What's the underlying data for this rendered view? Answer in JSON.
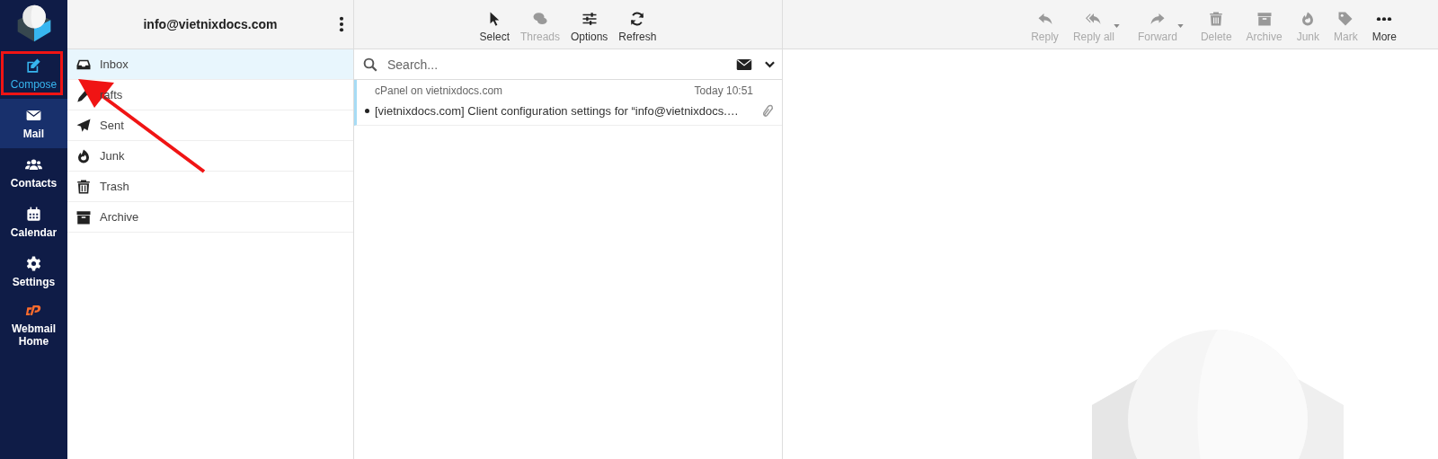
{
  "nav": [
    {
      "kind": "compose",
      "label": "Compose",
      "selected": false
    },
    {
      "kind": "mail",
      "label": "Mail",
      "selected": true
    },
    {
      "kind": "contacts",
      "label": "Contacts",
      "selected": false
    },
    {
      "kind": "calendar",
      "label": "Calendar",
      "selected": false
    },
    {
      "kind": "settings",
      "label": "Settings",
      "selected": false
    },
    {
      "kind": "cpanel",
      "label": "Webmail Home",
      "selected": false
    }
  ],
  "account": {
    "email": "info@vietnixdocs.com"
  },
  "folders": [
    {
      "kind": "inbox",
      "label": "Inbox",
      "selected": true
    },
    {
      "kind": "drafts",
      "label": "rafts",
      "selected": false
    },
    {
      "kind": "sent",
      "label": "Sent",
      "selected": false
    },
    {
      "kind": "junk",
      "label": "Junk",
      "selected": false
    },
    {
      "kind": "trash",
      "label": "Trash",
      "selected": false
    },
    {
      "kind": "archive",
      "label": "Archive",
      "selected": false
    }
  ],
  "list_toolbar": [
    {
      "kind": "select",
      "label": "Select",
      "disabled": false
    },
    {
      "kind": "threads",
      "label": "Threads",
      "disabled": true
    },
    {
      "kind": "options",
      "label": "Options",
      "disabled": false
    },
    {
      "kind": "refresh",
      "label": "Refresh",
      "disabled": false
    }
  ],
  "search": {
    "placeholder": "Search..."
  },
  "messages": [
    {
      "sender": "cPanel on vietnixdocs.com",
      "date": "Today 10:51",
      "subject": "[vietnixdocs.com] Client configuration settings for “info@vietnixdocs.…",
      "unread": true,
      "attachment": true,
      "selected": true
    }
  ],
  "message_toolbar": [
    {
      "kind": "reply",
      "label": "Reply",
      "disabled": true,
      "dropdown": false
    },
    {
      "kind": "replyall",
      "label": "Reply all",
      "disabled": true,
      "dropdown": true
    },
    {
      "kind": "forward",
      "label": "Forward",
      "disabled": true,
      "dropdown": true
    },
    {
      "kind": "delete",
      "label": "Delete",
      "disabled": true,
      "dropdown": false
    },
    {
      "kind": "archive",
      "label": "Archive",
      "disabled": true,
      "dropdown": false
    },
    {
      "kind": "junk",
      "label": "Junk",
      "disabled": true,
      "dropdown": false
    },
    {
      "kind": "mark",
      "label": "Mark",
      "disabled": true,
      "dropdown": false
    },
    {
      "kind": "more",
      "label": "More",
      "disabled": false,
      "dropdown": false
    }
  ]
}
